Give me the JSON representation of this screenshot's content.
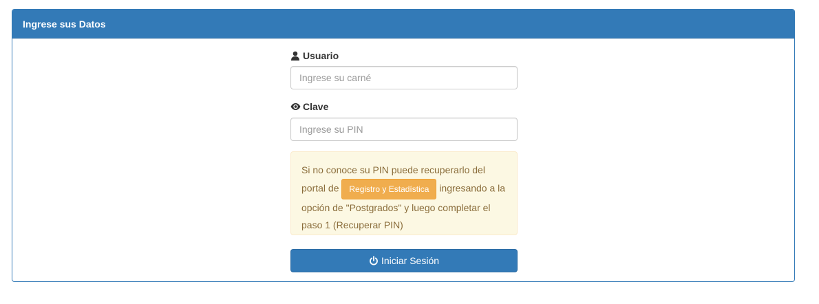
{
  "panel": {
    "title": "Ingrese sus Datos"
  },
  "usuario": {
    "label": "Usuario",
    "icon": "user-icon",
    "placeholder": "Ingrese su carné",
    "value": ""
  },
  "clave": {
    "label": "Clave",
    "icon": "eye-icon",
    "placeholder": "Ingrese su PIN",
    "value": ""
  },
  "alert": {
    "text_before": "Si no conoce su PIN puede recuperarlo del portal de",
    "link_label": "Registro y Estadística",
    "text_after": "ingresando a la opción de \"Postgrados\" y luego completar el paso 1 (Recuperar PIN)"
  },
  "login_button": {
    "label": "Iniciar Sesión",
    "icon": "power-icon"
  },
  "colors": {
    "primary": "#337ab7",
    "warning": "#f0ad4e",
    "alert_bg": "#fcf8e3",
    "alert_text": "#8a6d3b"
  }
}
